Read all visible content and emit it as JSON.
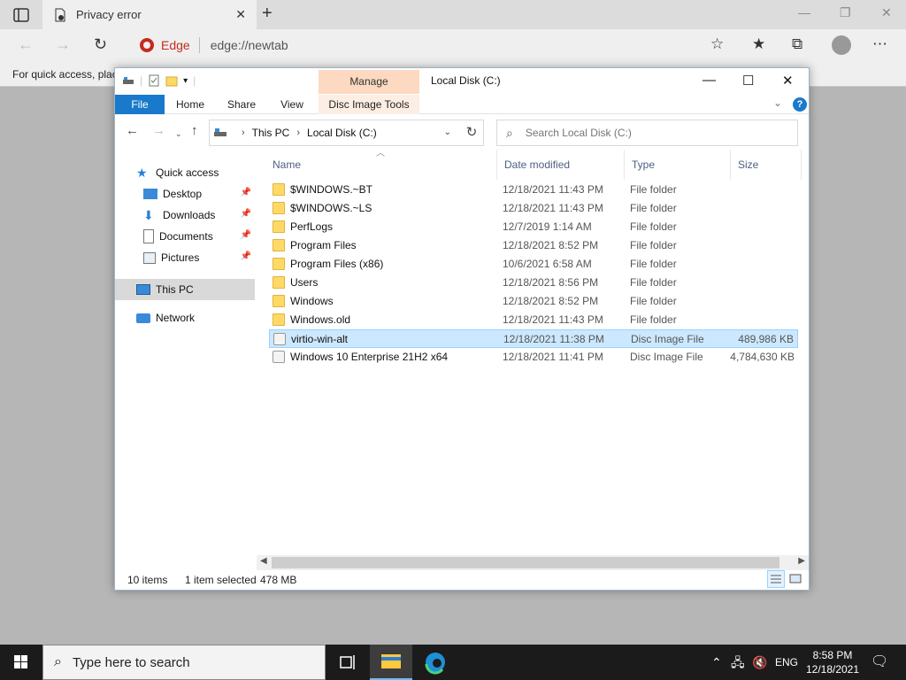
{
  "browser": {
    "tab_title": "Privacy error",
    "edge_label": "Edge",
    "url": "edge://newtab",
    "favorites_bar_text": "For quick access, place"
  },
  "explorer": {
    "title": "Local Disk (C:)",
    "manage_label": "Manage",
    "ribbon_tabs": [
      "File",
      "Home",
      "Share",
      "View",
      "Disc Image Tools"
    ],
    "breadcrumb": [
      "This PC",
      "Local Disk (C:)"
    ],
    "search_placeholder": "Search Local Disk (C:)",
    "nav": {
      "quick_access": "Quick access",
      "desktop": "Desktop",
      "downloads": "Downloads",
      "documents": "Documents",
      "pictures": "Pictures",
      "this_pc": "This PC",
      "network": "Network"
    },
    "columns": [
      "Name",
      "Date modified",
      "Type",
      "Size"
    ],
    "files": [
      {
        "name": "$WINDOWS.~BT",
        "date": "12/18/2021 11:43 PM",
        "type": "File folder",
        "size": ""
      },
      {
        "name": "$WINDOWS.~LS",
        "date": "12/18/2021 11:43 PM",
        "type": "File folder",
        "size": ""
      },
      {
        "name": "PerfLogs",
        "date": "12/7/2019 1:14 AM",
        "type": "File folder",
        "size": ""
      },
      {
        "name": "Program Files",
        "date": "12/18/2021 8:52 PM",
        "type": "File folder",
        "size": ""
      },
      {
        "name": "Program Files (x86)",
        "date": "10/6/2021 6:58 AM",
        "type": "File folder",
        "size": ""
      },
      {
        "name": "Users",
        "date": "12/18/2021 8:56 PM",
        "type": "File folder",
        "size": ""
      },
      {
        "name": "Windows",
        "date": "12/18/2021 8:52 PM",
        "type": "File folder",
        "size": ""
      },
      {
        "name": "Windows.old",
        "date": "12/18/2021 11:43 PM",
        "type": "File folder",
        "size": ""
      },
      {
        "name": "virtio-win-alt",
        "date": "12/18/2021 11:38 PM",
        "type": "Disc Image File",
        "size": "489,986 KB"
      },
      {
        "name": "Windows 10 Enterprise 21H2 x64",
        "date": "12/18/2021 11:41 PM",
        "type": "Disc Image File",
        "size": "4,784,630 KB"
      }
    ],
    "status": {
      "items": "10 items",
      "selected": "1 item selected",
      "size": "478 MB"
    }
  },
  "taskbar": {
    "search_placeholder": "Type here to search",
    "lang": "ENG",
    "time": "8:58 PM",
    "date": "12/18/2021"
  },
  "colors": {
    "accent": "#1979ca",
    "selection": "#cce8ff",
    "manage_tab": "#fcd9c0"
  }
}
